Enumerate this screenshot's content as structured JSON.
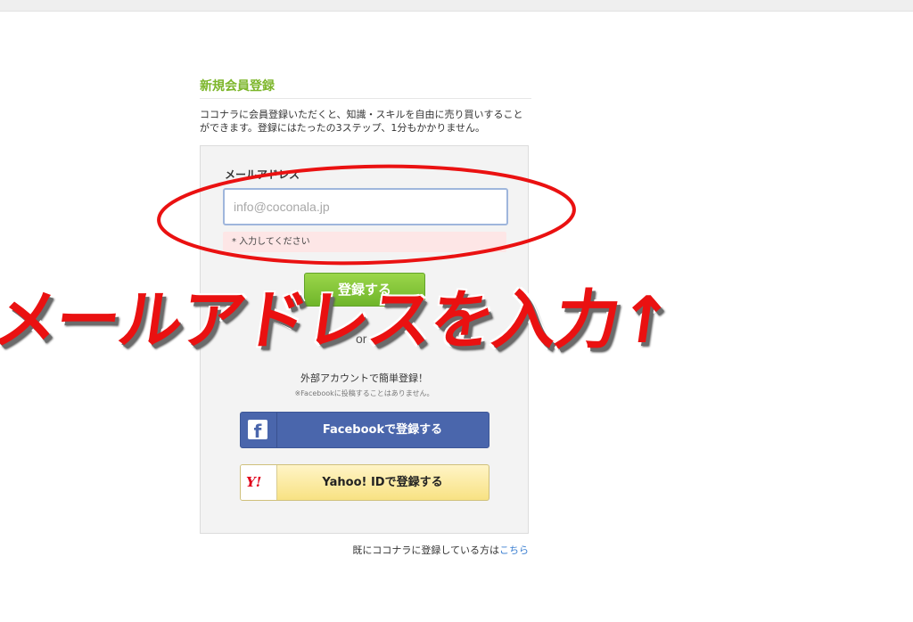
{
  "page": {
    "title": "新規会員登録",
    "intro": "ココナラに会員登録いただくと、知識・スキルを自由に売り買いすることができます。登録にはたったの3ステップ、1分もかかりません。"
  },
  "form": {
    "email_label": "メールアドレス",
    "email_placeholder": "info@coconala.jp",
    "email_value": "",
    "error_message": "* 入力してください",
    "submit_label": "登録する"
  },
  "social": {
    "or_text": "or",
    "heading": "外部アカウントで簡単登録！",
    "note": "※Facebookに投稿することはありません。",
    "facebook_label": "Facebookで登録する",
    "facebook_icon_glyph": "f",
    "yahoo_label": "Yahoo! IDで登録する",
    "yahoo_icon_glyph": "Y!"
  },
  "footer": {
    "login_prompt": "既にココナラに登録している方は",
    "login_link": "こちら"
  },
  "annotation": {
    "text": "メールアドレスを入力↑",
    "color": "#ea1111"
  },
  "colors": {
    "brand_green": "#7cb62a",
    "facebook_blue": "#4a66ac",
    "yahoo_yellow": "#f8e283",
    "link_blue": "#3b7fd1"
  }
}
